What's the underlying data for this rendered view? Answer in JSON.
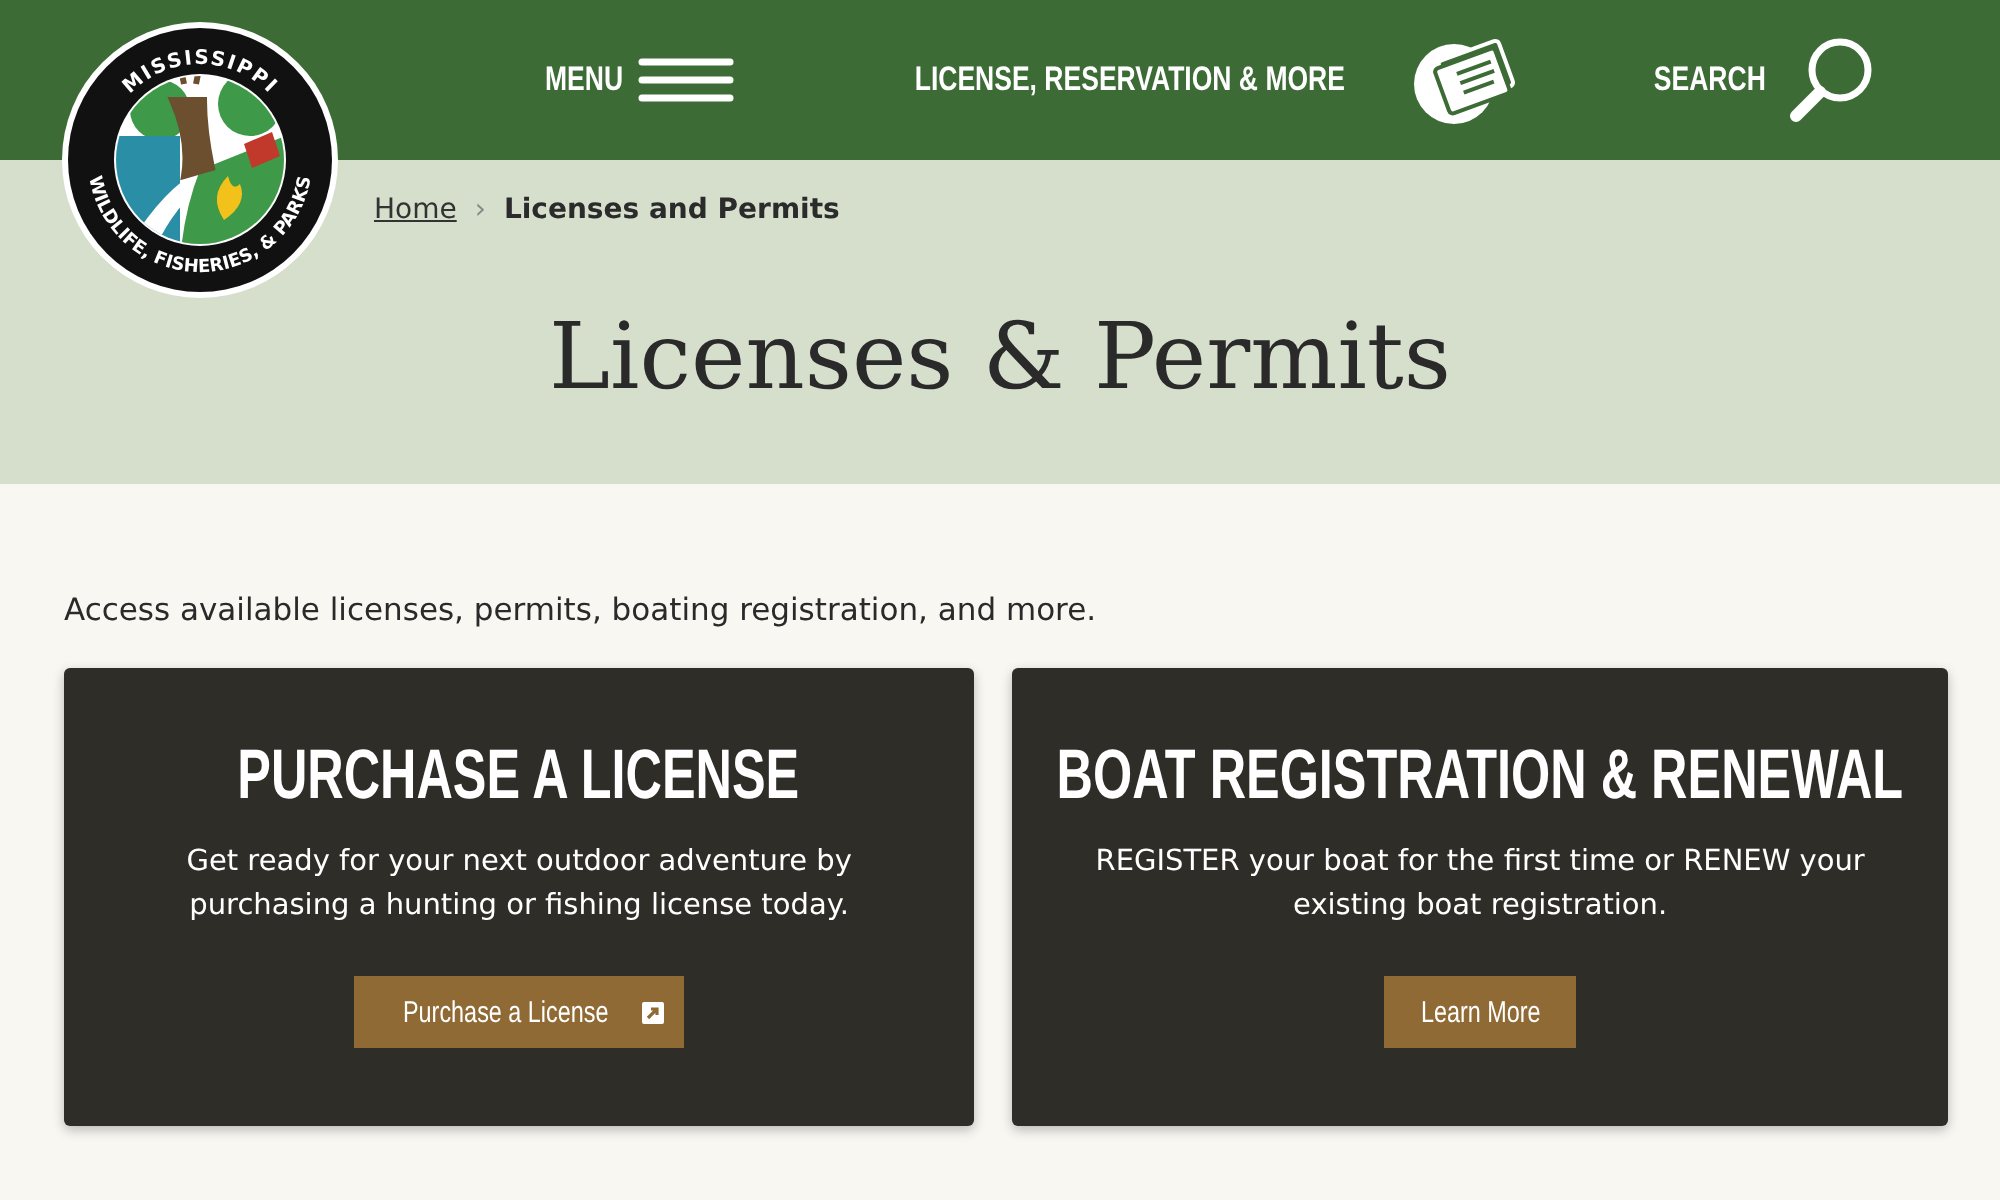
{
  "header": {
    "logo": {
      "top_text": "MISSISSIPPI",
      "bottom_text": "WILDLIFE, FISHERIES, & PARKS"
    },
    "nav": [
      {
        "label": "MENU",
        "kind": "menu"
      },
      {
        "label": "LICENSE, RESERVATION & MORE",
        "kind": "license"
      },
      {
        "label": "SEARCH",
        "kind": "search"
      }
    ]
  },
  "breadcrumb": {
    "separator": "›",
    "items": [
      {
        "label": "Home",
        "kind": "link"
      },
      {
        "label": "Licenses and Permits",
        "kind": "current"
      }
    ]
  },
  "page_title": "Licenses & Permits",
  "intro": "Access available licenses, permits, boating registration, and more.",
  "cards": [
    {
      "title": "PURCHASE A LICENSE",
      "description": "Get ready for your next outdoor adventure by purchasing a hunting or fishing license today.",
      "button": {
        "label": "Purchase a License",
        "external": true
      }
    },
    {
      "title": "BOAT REGISTRATION & RENEWAL",
      "description": "REGISTER your boat for the first time or RENEW your existing boat registration.",
      "button": {
        "label": "Learn More",
        "external": false
      }
    }
  ]
}
